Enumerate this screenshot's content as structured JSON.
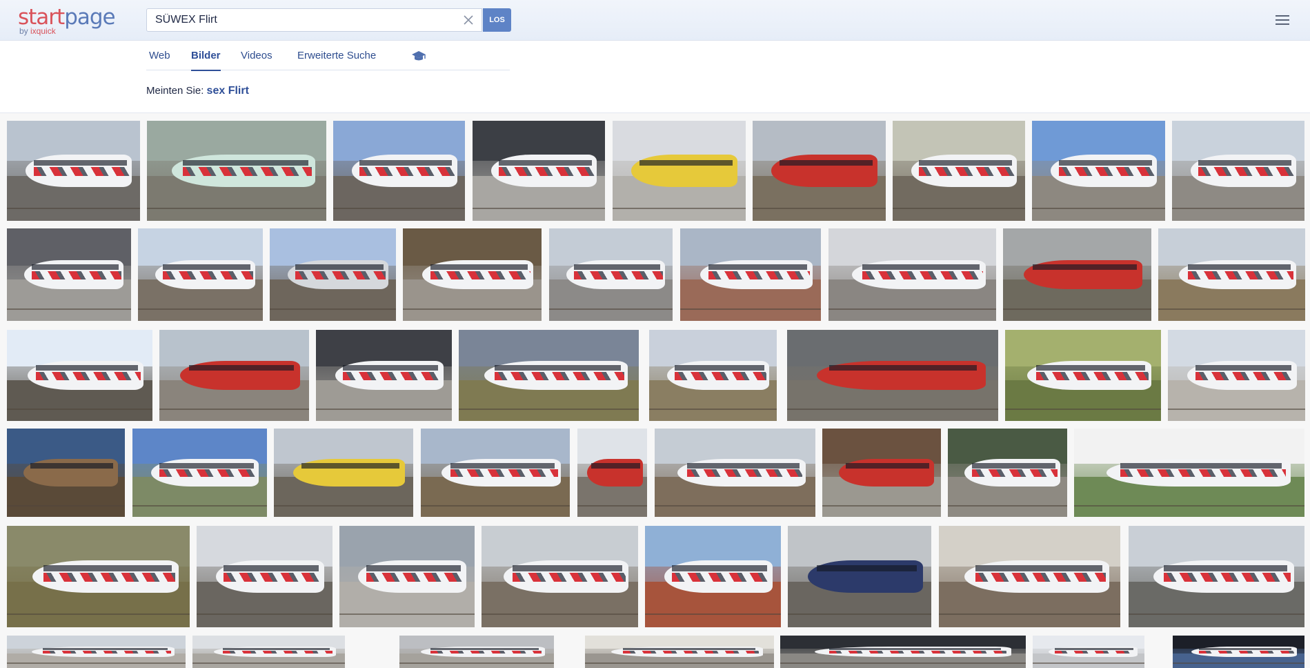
{
  "logo": {
    "main_start": "start",
    "main_page": "page",
    "sub_by": "by ",
    "sub_name": "ixquick"
  },
  "search": {
    "query": "SÜWEX Flirt",
    "button_label": "LOS"
  },
  "tabs": [
    {
      "label": "Web",
      "active": false
    },
    {
      "label": "Bilder",
      "active": true
    },
    {
      "label": "Videos",
      "active": false
    },
    {
      "label": "Erweiterte Suche",
      "active": false
    }
  ],
  "did_you_mean": {
    "prefix": "Meinten Sie: ",
    "suggestion": "sex Flirt"
  },
  "colors": {
    "accent": "#2f4f98",
    "button": "#5e83c6",
    "logo_red": "#d9525a",
    "logo_blue": "#5a7ab8"
  },
  "icons": {
    "clear": "close-icon",
    "menu": "hamburger-menu-icon",
    "family_filter": "graduation-cap-icon"
  },
  "image_results": [
    {
      "train": "white",
      "sky": "#b9c3cf",
      "ground": "#6d6a66"
    },
    {
      "train": "mint",
      "sky": "#9aa9a0",
      "ground": "#7c7a70"
    },
    {
      "train": "white",
      "sky": "#8aa8d6",
      "ground": "#6c6660"
    },
    {
      "train": "white",
      "sky": "#3c3f45",
      "ground": "#a8a6a2"
    },
    {
      "train": "yellow",
      "sky": "#d9dbe0",
      "ground": "#b2b0ab"
    },
    {
      "train": "red",
      "sky": "#b5bcc5",
      "ground": "#7a7060"
    },
    {
      "train": "white",
      "sky": "#c3c4b6",
      "ground": "#726b60"
    },
    {
      "train": "white",
      "sky": "#6f9ad6",
      "ground": "#8d8880"
    },
    {
      "train": "white",
      "sky": "#c9d2dc",
      "ground": "#8e8a84"
    },
    {
      "train": "white",
      "sky": "#5f6066",
      "ground": "#9d9b97"
    },
    {
      "train": "white",
      "sky": "#c6d3e3",
      "ground": "#7a7166"
    },
    {
      "train": "silver",
      "sky": "#a9bfe0",
      "ground": "#6e665c"
    },
    {
      "train": "white",
      "sky": "#6a5a45",
      "ground": "#9a948c"
    },
    {
      "train": "white",
      "sky": "#c4ccd6",
      "ground": "#8c8a88"
    },
    {
      "train": "white",
      "sky": "#aab6c6",
      "ground": "#9a6a58"
    },
    {
      "train": "white",
      "sky": "#d4d6da",
      "ground": "#8a8682"
    },
    {
      "train": "red",
      "sky": "#a4a7a8",
      "ground": "#6e6a5e"
    },
    {
      "train": "white",
      "sky": "#c7cfd8",
      "ground": "#8a7a5e"
    },
    {
      "train": "white",
      "sky": "#e2ebf6",
      "ground": "#5f5a52"
    },
    {
      "train": "red",
      "sky": "#b8c2cc",
      "ground": "#8a847c"
    },
    {
      "train": "white",
      "sky": "#3e4046",
      "ground": "#9e9b95"
    },
    {
      "train": "white",
      "sky": "#7a8597",
      "ground": "#7f7a52"
    },
    {
      "train": "white",
      "sky": "#c9d0db",
      "ground": "#8a7e62"
    },
    {
      "train": "red",
      "sky": "#6a6d70",
      "ground": "#77736b"
    },
    {
      "train": "white",
      "sky": "#a4b06e",
      "ground": "#6b7a44"
    },
    {
      "train": "white",
      "sky": "#d3dae3",
      "ground": "#b7b3ac"
    },
    {
      "train": "interior",
      "sky": "#3b5a86",
      "ground": "#5a4a38"
    },
    {
      "train": "white",
      "sky": "#5d86c8",
      "ground": "#7d8a66"
    },
    {
      "train": "yellow",
      "sky": "#bfc6cf",
      "ground": "#6c665c"
    },
    {
      "train": "white",
      "sky": "#a8b7cb",
      "ground": "#7a6a52"
    },
    {
      "train": "red",
      "sky": "#dfe3e8",
      "ground": "#7a746c"
    },
    {
      "train": "white",
      "sky": "#c5ccd4",
      "ground": "#7e6e5c"
    },
    {
      "train": "red",
      "sky": "#6b5240",
      "ground": "#9b9890"
    },
    {
      "train": "white",
      "sky": "#4a5a44",
      "ground": "#8e8a82"
    },
    {
      "train": "white",
      "sky": "#f2f2f2",
      "ground": "#6e8a56"
    },
    {
      "train": "white",
      "sky": "#8a8a6a",
      "ground": "#77704a"
    },
    {
      "train": "white",
      "sky": "#d6d9de",
      "ground": "#6a6660"
    },
    {
      "train": "white",
      "sky": "#9aa3ad",
      "ground": "#b1aea9"
    },
    {
      "train": "white",
      "sky": "#c8cdd2",
      "ground": "#7a7064"
    },
    {
      "train": "white",
      "sky": "#8fb0d6",
      "ground": "#a7543c"
    },
    {
      "train": "blue",
      "sky": "#c0c4c8",
      "ground": "#6a6660"
    },
    {
      "train": "white",
      "sky": "#d4d0c8",
      "ground": "#7c6e60"
    },
    {
      "train": "white",
      "sky": "#c9cfd6",
      "ground": "#6a6a66"
    },
    {
      "train": "white",
      "sky": "#cdd3da",
      "ground": "#b0aca6"
    },
    {
      "train": "white",
      "sky": "#dcdfe3",
      "ground": "#a9a6a0"
    },
    {
      "train": "white",
      "sky": "#bcbec2",
      "ground": "#a5a29c"
    },
    {
      "train": "white",
      "sky": "#e2e0da",
      "ground": "#9a9690"
    },
    {
      "train": "white",
      "sky": "#2c2f35",
      "ground": "#8a8884"
    },
    {
      "train": "white",
      "sky": "#e6e9ee",
      "ground": "#c3c5c8"
    },
    {
      "train": "white",
      "sky": "#1c1f28",
      "ground": "#47628e"
    }
  ]
}
